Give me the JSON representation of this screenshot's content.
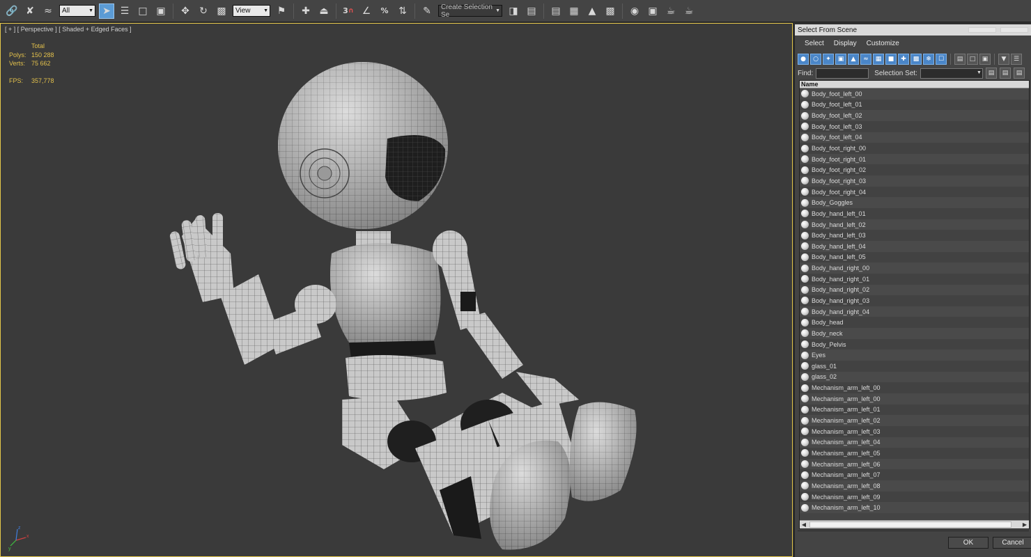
{
  "toolbar": {
    "filter_dropdown": "All",
    "refcoord_dropdown": "View",
    "selection_set_dropdown": "Create Selection Se",
    "snap_label": "3",
    "percent_snap_label": "%"
  },
  "viewport": {
    "label": "[ + ] [ Perspective ] [ Shaded + Edged Faces ]",
    "stats": {
      "total_label": "Total",
      "polys_label": "Polys:",
      "polys_value": "150 288",
      "verts_label": "Verts:",
      "verts_value": "75 662",
      "fps_label": "FPS:",
      "fps_value": "357,778"
    },
    "gizmo": {
      "x": "x",
      "y": "y",
      "z": "z"
    }
  },
  "dialog": {
    "title": "Select From Scene",
    "menu": [
      "Select",
      "Display",
      "Customize"
    ],
    "find_label": "Find:",
    "find_value": "",
    "selection_set_label": "Selection Set:",
    "selection_set_value": "",
    "column_header": "Name",
    "items": [
      "Body_foot_left_00",
      "Body_foot_left_01",
      "Body_foot_left_02",
      "Body_foot_left_03",
      "Body_foot_left_04",
      "Body_foot_right_00",
      "Body_foot_right_01",
      "Body_foot_right_02",
      "Body_foot_right_03",
      "Body_foot_right_04",
      "Body_Goggles",
      "Body_hand_left_01",
      "Body_hand_left_02",
      "Body_hand_left_03",
      "Body_hand_left_04",
      "Body_hand_left_05",
      "Body_hand_right_00",
      "Body_hand_right_01",
      "Body_hand_right_02",
      "Body_hand_right_03",
      "Body_hand_right_04",
      "Body_head",
      "Body_neck",
      "Body_Pelvis",
      "Eyes",
      "glass_01",
      "glass_02",
      "Mechanism_arm_left_00",
      "Mechanism_arm_left_00",
      "Mechanism_arm_left_01",
      "Mechanism_arm_left_02",
      "Mechanism_arm_left_03",
      "Mechanism_arm_left_04",
      "Mechanism_arm_left_05",
      "Mechanism_arm_left_06",
      "Mechanism_arm_left_07",
      "Mechanism_arm_left_08",
      "Mechanism_arm_left_09",
      "Mechanism_arm_left_10"
    ],
    "ok_label": "OK",
    "cancel_label": "Cancel"
  }
}
